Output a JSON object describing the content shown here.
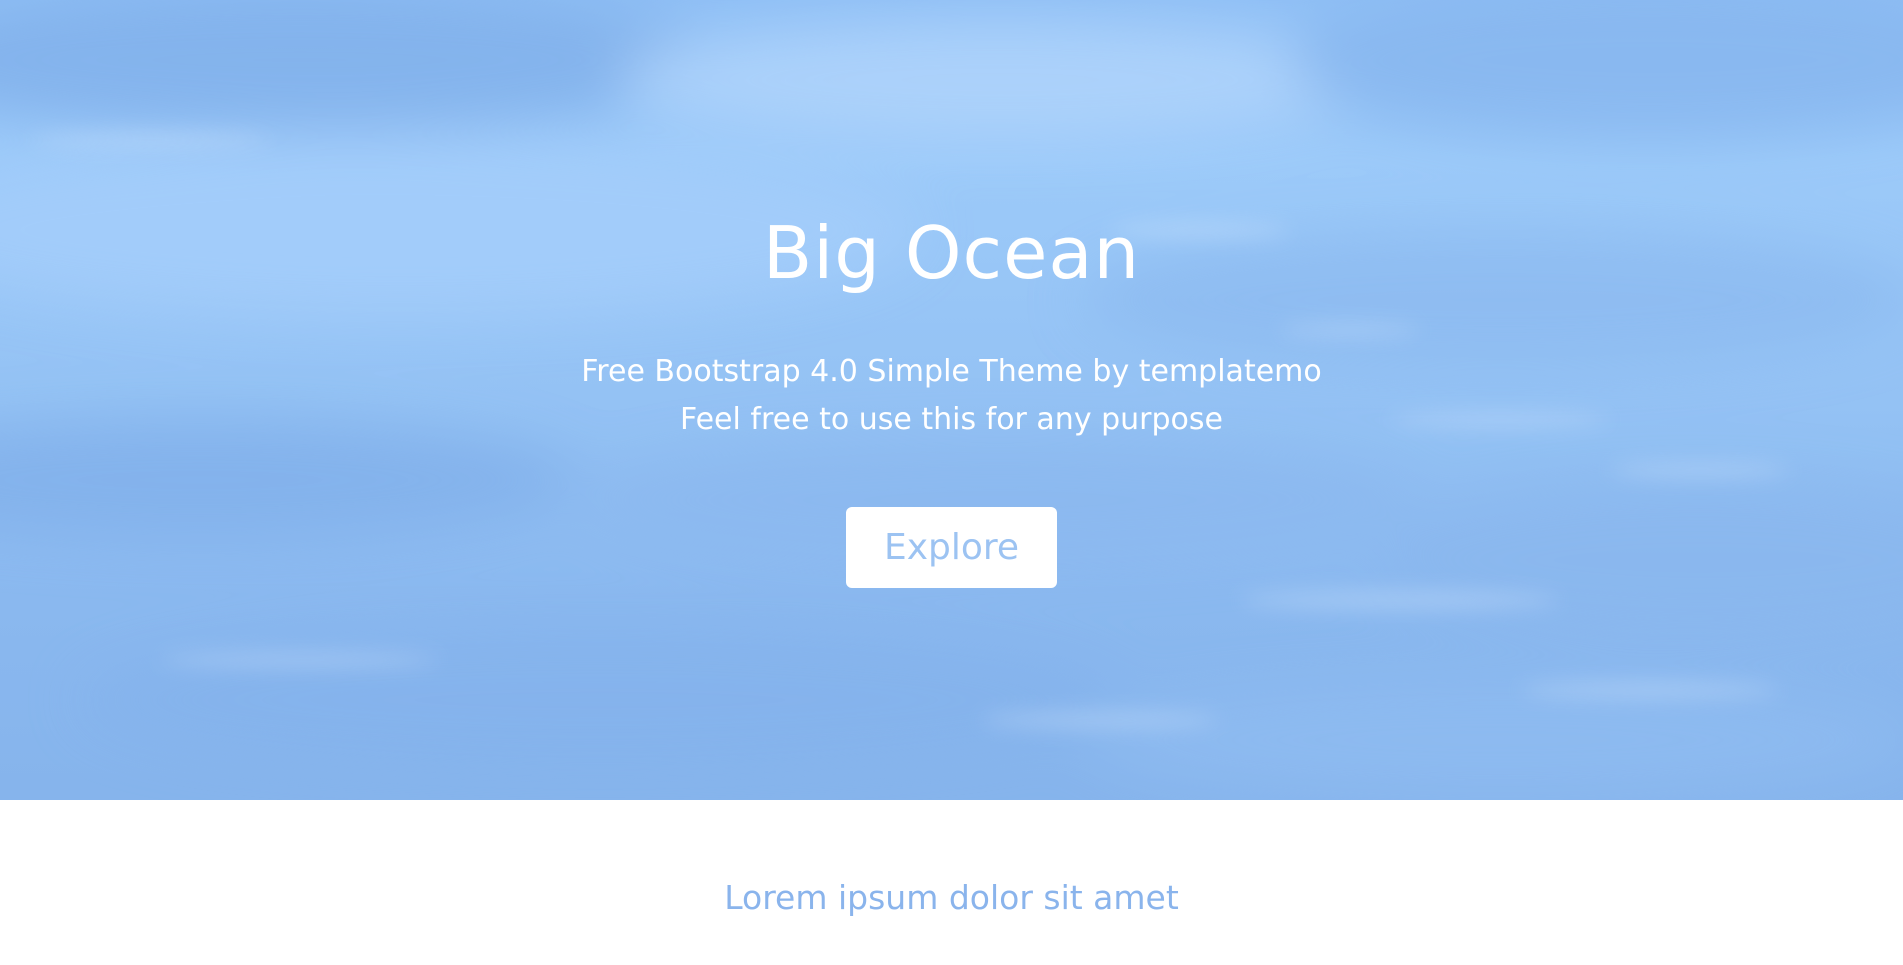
{
  "hero": {
    "title": "Big Ocean",
    "subtitle_line1": "Free Bootstrap 4.0 Simple Theme by templatemo",
    "subtitle_line2": "Feel free to use this for any purpose",
    "button_label": "Explore"
  },
  "section": {
    "heading": "Lorem ipsum dolor sit amet"
  },
  "colors": {
    "hero_overlay": "#94c2f4",
    "text_white": "#ffffff",
    "accent_blue": "#8ab4ec",
    "button_text": "#9cc3f2"
  }
}
